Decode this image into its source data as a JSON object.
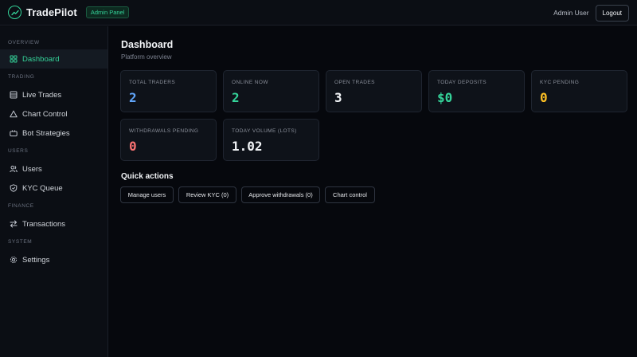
{
  "topbar": {
    "brand_name": "TradePilot",
    "brand_badge": "Admin Panel",
    "user_name": "Admin User",
    "logout_label": "Logout"
  },
  "sidebar": {
    "sections": [
      {
        "label": "OVERVIEW",
        "items": [
          {
            "label": "Dashboard",
            "icon": "grid-icon",
            "active": true
          }
        ]
      },
      {
        "label": "TRADING",
        "items": [
          {
            "label": "Live Trades",
            "icon": "list-icon"
          },
          {
            "label": "Chart Control",
            "icon": "triangle-icon"
          },
          {
            "label": "Bot Strategies",
            "icon": "bot-icon"
          }
        ]
      },
      {
        "label": "USERS",
        "items": [
          {
            "label": "Users",
            "icon": "users-icon"
          },
          {
            "label": "KYC Queue",
            "icon": "shield-icon"
          }
        ]
      },
      {
        "label": "FINANCE",
        "items": [
          {
            "label": "Transactions",
            "icon": "transfer-icon"
          }
        ]
      },
      {
        "label": "SYSTEM",
        "items": [
          {
            "label": "Settings",
            "icon": "gear-icon"
          }
        ]
      }
    ]
  },
  "main": {
    "title": "Dashboard",
    "subtitle": "Platform overview",
    "stats": [
      {
        "label": "TOTAL TRADERS",
        "value": "2",
        "color": "#60a5fa"
      },
      {
        "label": "ONLINE NOW",
        "value": "2",
        "color": "#34d399"
      },
      {
        "label": "OPEN TRADES",
        "value": "3",
        "color": "#f2f4f7"
      },
      {
        "label": "TODAY DEPOSITS",
        "value": "$0",
        "color": "#34d399"
      },
      {
        "label": "KYC PENDING",
        "value": "0",
        "color": "#fbbf24"
      },
      {
        "label": "WITHDRAWALS PENDING",
        "value": "0",
        "color": "#f87171"
      },
      {
        "label": "TODAY VOLUME (LOTS)",
        "value": "1.02",
        "color": "#f2f4f7"
      }
    ],
    "quick_actions_title": "Quick actions",
    "quick_actions": [
      "Manage users",
      "Review KYC (0)",
      "Approve withdrawals (0)",
      "Chart control"
    ]
  }
}
